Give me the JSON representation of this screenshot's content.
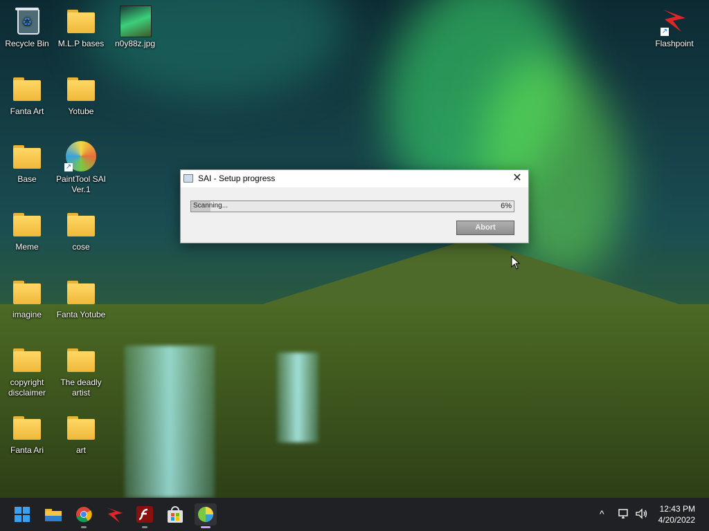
{
  "desktop": {
    "icons": [
      {
        "label": "Recycle Bin"
      },
      {
        "label": "M.L.P bases"
      },
      {
        "label": "n0y88z.jpg"
      },
      {
        "label": "Fanta Art"
      },
      {
        "label": "Yotube"
      },
      {
        "label": "Base"
      },
      {
        "label": "PaintTool SAI Ver.1"
      },
      {
        "label": "Meme"
      },
      {
        "label": "cose"
      },
      {
        "label": "imagine"
      },
      {
        "label": "Fanta Yotube"
      },
      {
        "label": "copyright disclaimer"
      },
      {
        "label": "The deadly artist"
      },
      {
        "label": "Fanta Ari"
      },
      {
        "label": "art"
      },
      {
        "label": "Flashpoint"
      }
    ]
  },
  "dialog": {
    "title": "SAI - Setup progress",
    "close_glyph": "✕",
    "status_text": "Scanning...",
    "progress_percent_label": "6%",
    "progress_value": 0.06,
    "abort_label": "Abort"
  },
  "taskbar": {
    "items": [
      "start-icon",
      "file-explorer-icon",
      "chrome-icon",
      "flashpoint-icon",
      "flash-icon",
      "store-icon",
      "paint-tool-sai-icon"
    ],
    "tray": {
      "chevron": "^"
    },
    "time": "12:43 PM",
    "date": "4/20/2022"
  },
  "colors": {
    "taskbar": "#202124",
    "folder": "#f0b83a",
    "dialog_bg": "#f0f0f0"
  }
}
